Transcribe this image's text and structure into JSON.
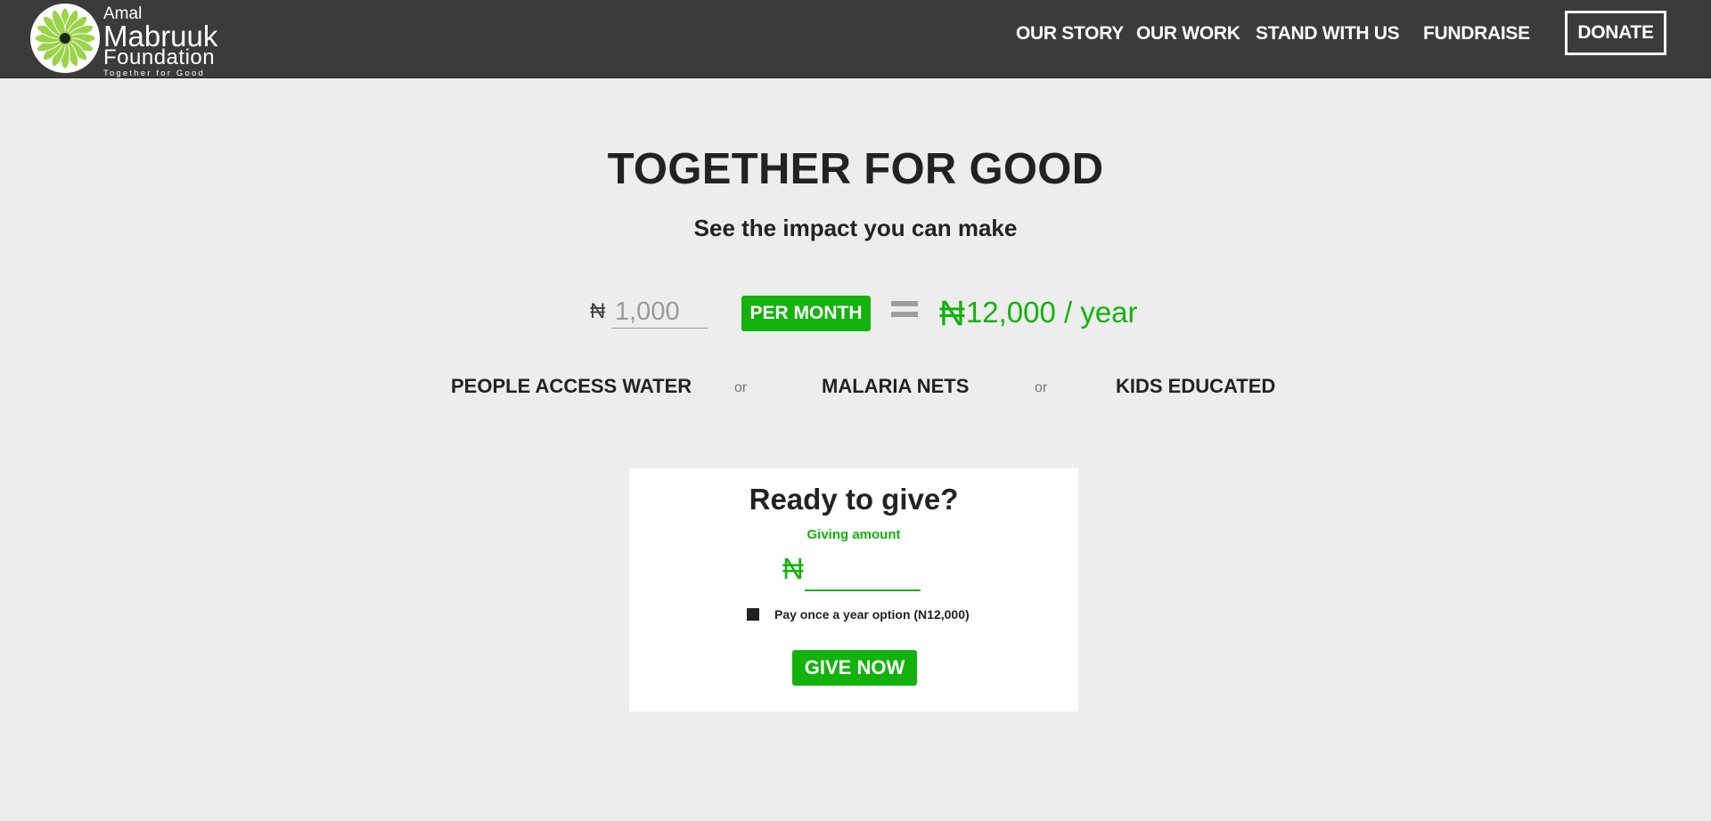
{
  "brand": {
    "line1": "Amal",
    "line2": "Mabruuk",
    "line3": "Foundation",
    "tagline": "Together for Good",
    "icon": "flower-logo-icon",
    "logo_colors": {
      "petals": "#9bd34a",
      "center": "#222222"
    }
  },
  "nav": {
    "items": [
      {
        "label": "OUR STORY"
      },
      {
        "label": "OUR WORK"
      },
      {
        "label": "STAND WITH US"
      },
      {
        "label": "FUNDRAISE"
      }
    ],
    "donate_label": "DONATE"
  },
  "hero": {
    "title": "TOGETHER FOR GOOD",
    "subtitle": "See the impact you can make"
  },
  "calculator": {
    "currency_symbol": "₦",
    "amount_placeholder": "1,000",
    "frequency_label": "PER MONTH",
    "result_symbol": "₦",
    "result_text": "12,000 / year"
  },
  "impact": {
    "items": [
      {
        "label": "PEOPLE ACCESS WATER"
      },
      {
        "label": "MALARIA NETS"
      },
      {
        "label": "KIDS EDUCATED"
      }
    ],
    "separator": "or"
  },
  "give_card": {
    "title": "Ready to give?",
    "amount_label": "Giving amount",
    "currency_symbol": "₦",
    "amount_value": "",
    "yearly_option_label": "Pay once a year option (N12,000)",
    "button_label": "GIVE NOW"
  },
  "colors": {
    "accent_green": "#13b20d",
    "header_bg": "#3b3b3b",
    "page_bg": "#ededed"
  }
}
